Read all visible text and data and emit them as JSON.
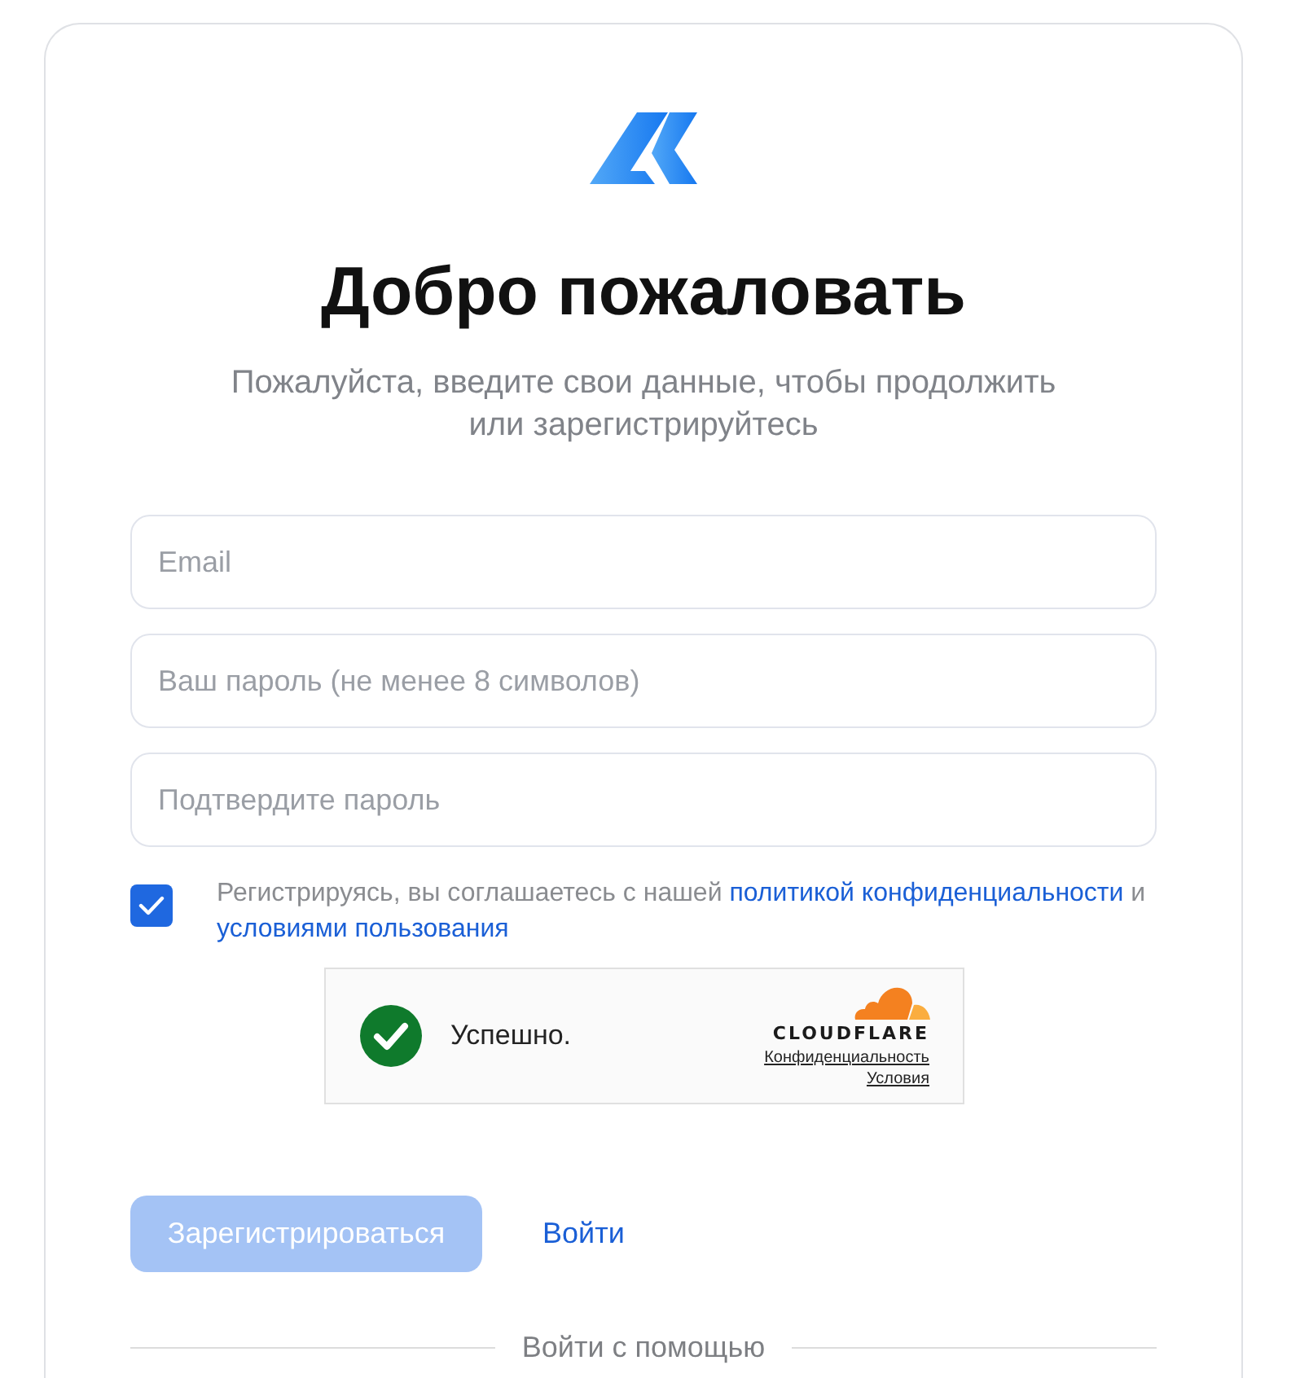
{
  "title": "Добро пожаловать",
  "subtitle": "Пожалуйста, введите свои данные, чтобы продолжить или зарегистрируйтесь",
  "fields": [
    {
      "placeholder": "Email"
    },
    {
      "placeholder": "Ваш пароль (не менее 8 символов)"
    },
    {
      "placeholder": "Подтвердите пароль"
    }
  ],
  "consent": {
    "checked": true,
    "parts": [
      {
        "kind": "text",
        "text": "Регистрируясь, вы соглашаетесь с нашей"
      },
      {
        "kind": "link",
        "text": "политикой конфиденциальности"
      },
      {
        "kind": "text",
        "text": "и"
      },
      {
        "kind": "link",
        "text": "условиями пользования"
      }
    ]
  },
  "captcha": {
    "verified": true,
    "status": "Успешно.",
    "brand": "CLOUDFLARE",
    "links": [
      "Конфиденциальность",
      "Условия"
    ]
  },
  "actions": [
    {
      "kind": "primary",
      "label": "Зарегистрироваться",
      "disabled": true
    },
    {
      "kind": "link",
      "label": "Войти"
    }
  ],
  "divider": "Войти с помощью"
}
